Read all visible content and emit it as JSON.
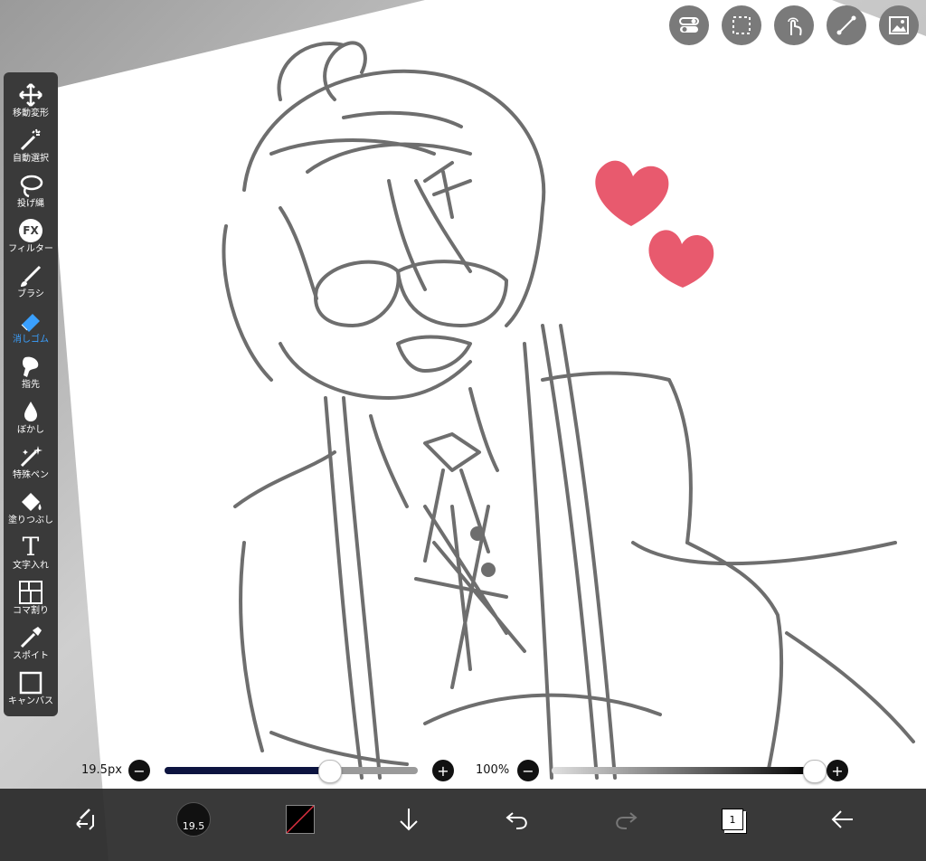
{
  "toolbar": {
    "tools": [
      {
        "label": "移動変形",
        "icon": "move-transform-icon"
      },
      {
        "label": "自動選択",
        "icon": "magic-wand-icon"
      },
      {
        "label": "投げ縄",
        "icon": "lasso-icon"
      },
      {
        "label": "フィルター",
        "icon": "filter-fx-icon"
      },
      {
        "label": "ブラシ",
        "icon": "brush-icon"
      },
      {
        "label": "消しゴム",
        "icon": "eraser-icon",
        "active": true
      },
      {
        "label": "指先",
        "icon": "smudge-finger-icon"
      },
      {
        "label": "ぼかし",
        "icon": "blur-drop-icon"
      },
      {
        "label": "特殊ペン",
        "icon": "special-pen-icon"
      },
      {
        "label": "塗りつぶし",
        "icon": "fill-bucket-icon"
      },
      {
        "label": "文字入れ",
        "icon": "text-icon"
      },
      {
        "label": "コマ割り",
        "icon": "frame-divider-icon"
      },
      {
        "label": "スポイト",
        "icon": "eyedropper-icon"
      },
      {
        "label": "キャンバス",
        "icon": "canvas-icon"
      }
    ],
    "fx_text": "FX",
    "text_tool_glyph": "T"
  },
  "top_buttons": [
    "toggle-icon",
    "selection-icon",
    "touch-icon",
    "ruler-icon",
    "image-icon"
  ],
  "brush_slider": {
    "value_label": "19.5px",
    "minus": "−",
    "plus": "+",
    "level": 0.65
  },
  "opacity_slider": {
    "value_label": "100%",
    "minus": "−",
    "plus": "+",
    "level": 1.0
  },
  "bottom_bar": {
    "brush_size_value": "19.5",
    "layer_count": "1",
    "items": [
      "swap-icon",
      "brush-size-indicator",
      "color-swatch",
      "download-arrow-icon",
      "undo-icon",
      "redo-icon",
      "layers-icon",
      "back-arrow-icon"
    ]
  },
  "colors": {
    "toolbar_bg": "#3a3a3a",
    "active_tool": "#3aa0ff",
    "heart": "#e85a6e",
    "slider_fill": "#0d1440",
    "sketch_stroke": "#6e6e6e"
  }
}
